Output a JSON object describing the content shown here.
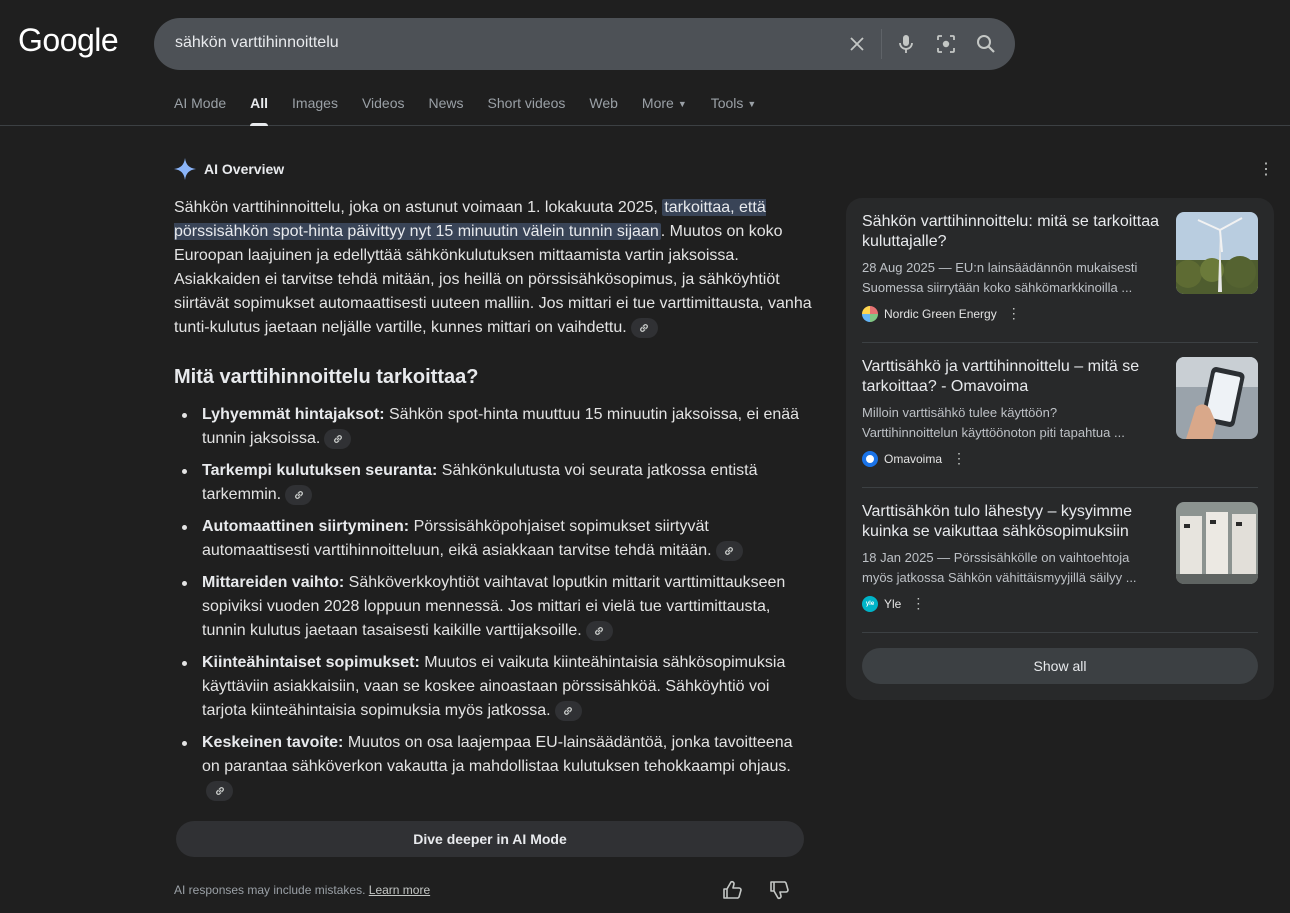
{
  "header": {
    "logo": "Google",
    "search_value": "sähkön varttihinnoittelu"
  },
  "tabs": [
    {
      "label": "AI Mode"
    },
    {
      "label": "All"
    },
    {
      "label": "Images"
    },
    {
      "label": "Videos"
    },
    {
      "label": "News"
    },
    {
      "label": "Short videos"
    },
    {
      "label": "Web"
    },
    {
      "label": "More"
    },
    {
      "label": "Tools"
    }
  ],
  "ai_overview": {
    "title": "AI Overview",
    "intro_before": "Sähkön varttihinnoittelu, joka on astunut voimaan 1. lokakuuta 2025, ",
    "intro_highlight": "tarkoittaa, että pörssisähkön spot-hinta päivittyy nyt 15 minuutin välein tunnin sijaan",
    "intro_after": ". Muutos on koko Euroopan laajuinen ja edellyttää sähkönkulutuksen mittaamista vartin jaksoissa. Asiakkaiden ei tarvitse tehdä mitään, jos heillä on pörssisähkösopimus, ja sähköyhtiöt siirtävät sopimukset automaattisesti uuteen malliin. Jos mittari ei tue varttimittausta, vanha tunti-kulutus jaetaan neljälle vartille, kunnes mittari on vaihdettu.",
    "heading": "Mitä varttihinnoittelu tarkoittaa?",
    "bullets": [
      {
        "term": "Lyhyemmät hintajaksot:",
        "text": " Sähkön spot-hinta muuttuu 15 minuutin jaksoissa, ei enää tunnin jaksoissa."
      },
      {
        "term": "Tarkempi kulutuksen seuranta:",
        "text": " Sähkönkulutusta voi seurata jatkossa entistä tarkemmin."
      },
      {
        "term": "Automaattinen siirtyminen:",
        "text": " Pörssisähköpohjaiset sopimukset siirtyvät automaattisesti varttihinnoitteluun, eikä asiakkaan tarvitse tehdä mitään."
      },
      {
        "term": "Mittareiden vaihto:",
        "text": " Sähköverkkoyhtiöt vaihtavat loputkin mittarit varttimittaukseen sopiviksi vuoden 2028 loppuun mennessä. Jos mittari ei vielä tue varttimittausta, tunnin kulutus jaetaan tasaisesti kaikille varttijaksoille."
      },
      {
        "term": "Kiinteähintaiset sopimukset:",
        "text": " Muutos ei vaikuta kiinteähintaisia sähkösopimuksia käyttäviin asiakkaisiin, vaan se koskee ainoastaan pörssisähköä. Sähköyhtiö voi tarjota kiinteähintaisia sopimuksia myös jatkossa."
      },
      {
        "term": "Keskeinen tavoite:",
        "text": " Muutos on osa laajempaa EU-lainsäädäntöä, jonka tavoitteena on parantaa sähköverkon vakautta ja mahdollistaa kulutuksen tehokkaampi ohjaus."
      }
    ],
    "dive_button": "Dive deeper in AI Mode",
    "disclaimer": "AI responses may include mistakes.",
    "learn_more": "Learn more"
  },
  "sources": [
    {
      "title": "Sähkön varttihinnoittelu: mitä se tarkoittaa kuluttajalle?",
      "snippet_line1": "28 Aug 2025 — EU:n lainsäädännön mukaisesti",
      "snippet_line2": "Suomessa siirrytään koko sähkömarkkinoilla ...",
      "source": "Nordic Green Energy"
    },
    {
      "title": "Varttisähkö ja varttihinnoittelu – mitä se tarkoittaa? - Omavoima",
      "snippet_line1": "Milloin varttisähkö tulee käyttöön?",
      "snippet_line2": "Varttihinnoittelun käyttöönoton piti tapahtua ...",
      "source": "Omavoima"
    },
    {
      "title": "Varttisähkön tulo lähestyy – kysyimme kuinka se vaikuttaa sähkösopimuksiin",
      "snippet_line1": "18 Jan 2025 — Pörssisähkölle on vaihtoehtoja",
      "snippet_line2": "myös jatkossa Sähkön vähittäismyyjillä säilyy ...",
      "source": "Yle"
    }
  ],
  "show_all": "Show all",
  "colors": {
    "background": "#1f1f1f",
    "highlight": "#394457",
    "side_panel": "#28292a"
  }
}
